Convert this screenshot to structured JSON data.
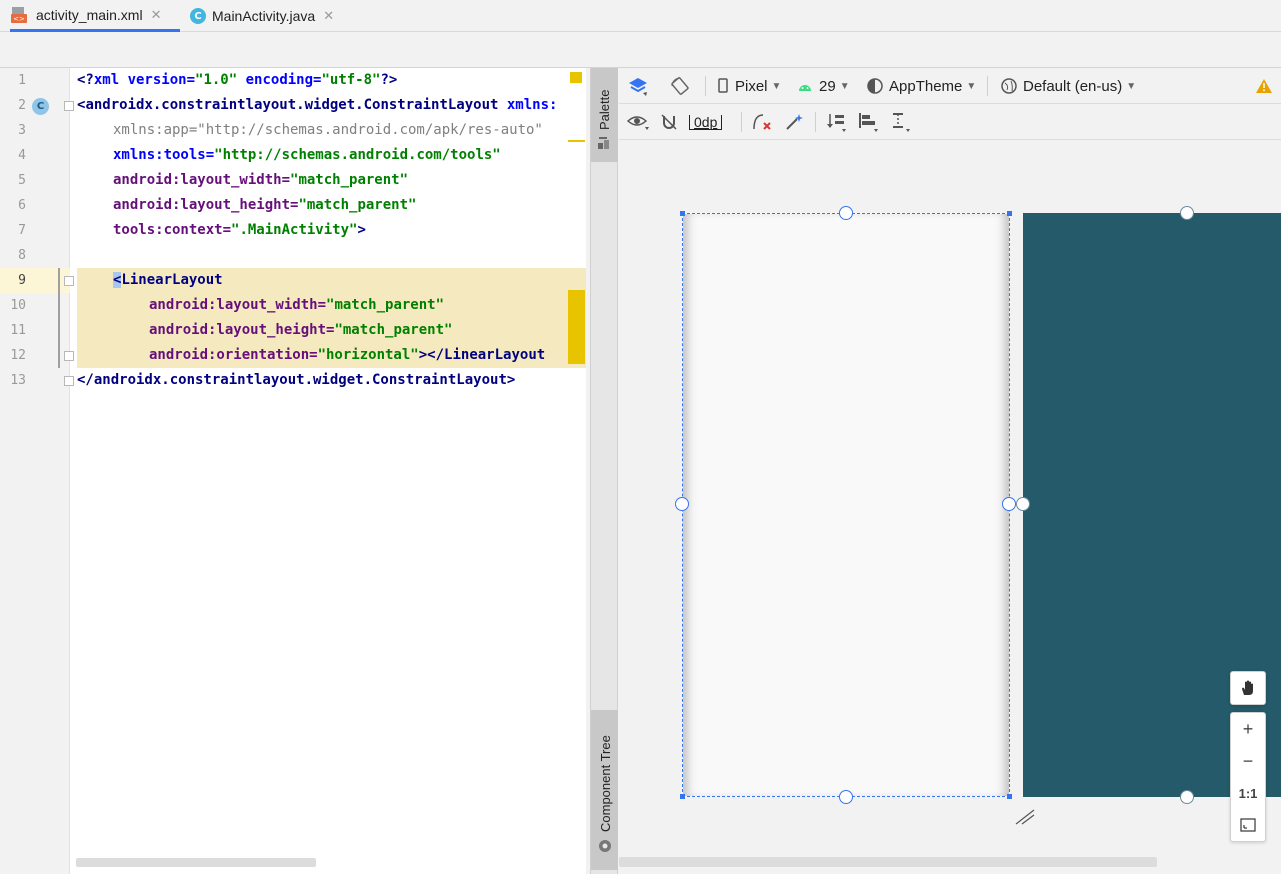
{
  "tabs": [
    {
      "label": "activity_main.xml",
      "active": true,
      "icon": "xml-file-icon"
    },
    {
      "label": "MainActivity.java",
      "active": false,
      "icon": "java-class-icon"
    }
  ],
  "line_numbers": [
    "1",
    "2",
    "3",
    "4",
    "5",
    "6",
    "7",
    "8",
    "9",
    "10",
    "11",
    "12",
    "13"
  ],
  "code": {
    "l1": {
      "a": "<?",
      "b": "xml version=",
      "c": "\"1.0\"",
      "d": " encoding=",
      "e": "\"utf-8\"",
      "f": "?>"
    },
    "l2": {
      "a": "<",
      "b": "androidx.constraintlayout.widget.ConstraintLayout",
      "c": " xmlns:"
    },
    "l3": {
      "a": "xmlns:app=\"http://schemas.android.com/apk/res-auto\""
    },
    "l4": {
      "a": "xmlns:tools=",
      "b": "\"http://schemas.android.com/tools\""
    },
    "l5": {
      "a": "android:layout_width=",
      "b": "\"match_parent\""
    },
    "l6": {
      "a": "android:layout_height=",
      "b": "\"match_parent\""
    },
    "l7": {
      "a": "tools:context=",
      "b": "\".MainActivity\"",
      "c": ">"
    },
    "l9": {
      "a": "<",
      "b": "LinearLayout"
    },
    "l10": {
      "a": "android:layout_width=",
      "b": "\"match_parent\""
    },
    "l11": {
      "a": "android:layout_height=",
      "b": "\"match_parent\""
    },
    "l12": {
      "a": "android:orientation=",
      "b": "\"horizontal\"",
      "c": "></",
      "d": "LinearLayout"
    },
    "l13": {
      "a": "</",
      "b": "androidx.constraintlayout.widget.ConstraintLayout",
      "c": ">"
    }
  },
  "side_tabs": {
    "palette": "Palette",
    "component_tree": "Component Tree"
  },
  "toolbar": {
    "device": "Pixel",
    "api": "29",
    "theme": "AppTheme",
    "locale": "Default (en-us)",
    "margin": "0dp"
  },
  "zoom": {
    "plus": "+",
    "minus": "−",
    "one_to_one": "1:1"
  },
  "colors": {
    "accent": "#3574f0",
    "blueprint": "#245a6a",
    "highlight": "#f5eabf",
    "warning": "#e8a300"
  }
}
